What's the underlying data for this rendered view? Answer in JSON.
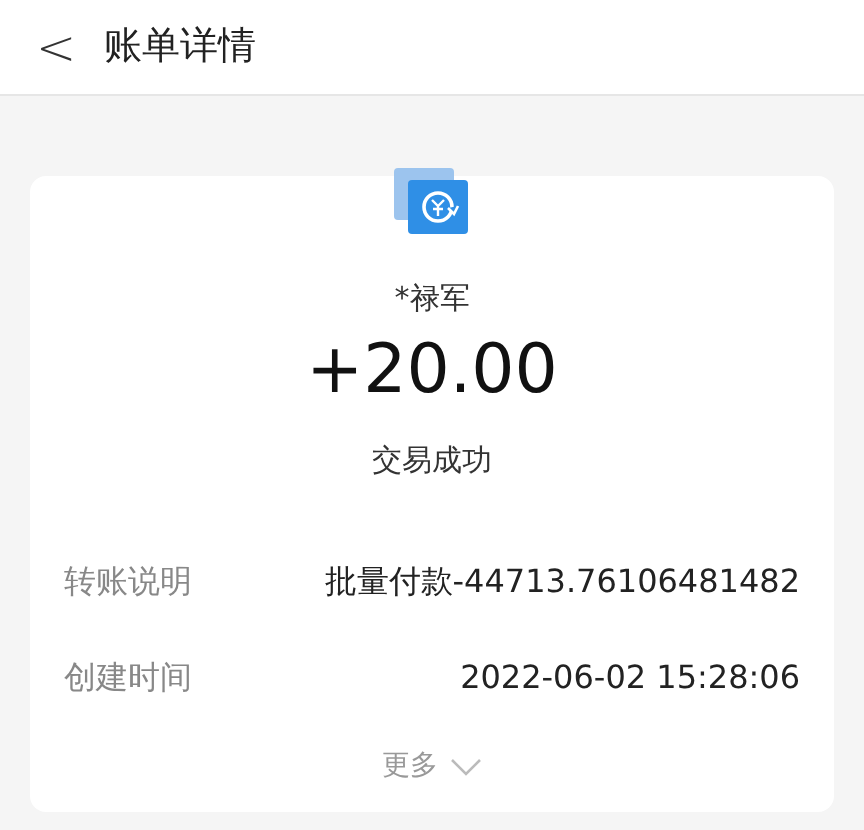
{
  "header": {
    "back": "<",
    "title": "账单详情"
  },
  "summary": {
    "name": "*禄军",
    "amount": "+20.00",
    "status": "交易成功"
  },
  "details": [
    {
      "label": "转账说明",
      "value": "批量付款-44713.76106481482"
    },
    {
      "label": "创建时间",
      "value": "2022-06-02 15:28:06"
    }
  ],
  "more": "更多"
}
